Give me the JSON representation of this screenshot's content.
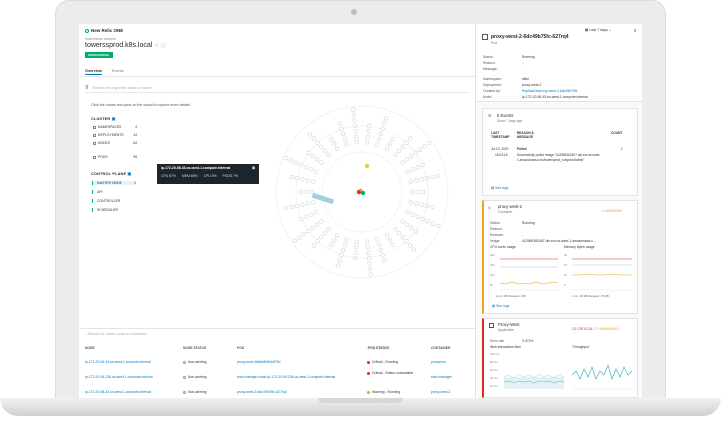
{
  "app": {
    "logo_text": "New Relic ONE",
    "breadcrumb": "Kubernetes clusters",
    "cluster_name": "towerssprod.k8s.local",
    "status_badge": "OPERATIONAL"
  },
  "tabs": [
    "Overview",
    "Events"
  ],
  "filter": {
    "placeholder": "Search for a specific node or name"
  },
  "hint": "Click the nodes and pods on the visual to explore more details.",
  "cluster": {
    "heading": "CLUSTER",
    "rows": [
      {
        "label": "NAMESPACES",
        "value": "4"
      },
      {
        "label": "DEPLOYMENTS",
        "value": "44"
      },
      {
        "label": "NODES",
        "value": "64"
      },
      {
        "label": "PODS",
        "value": "99"
      }
    ]
  },
  "control_plane": {
    "heading": "CONTROL PLANE",
    "items": [
      "MASTER NODE",
      "API",
      "CONTROLLER",
      "SCHEDULER"
    ],
    "master_count": "1"
  },
  "tooltip": {
    "title": "ip-172-20-58-43.us-west-1.compute.internal",
    "metrics": [
      "CPU 57%",
      "MEM 65%",
      "CPU 3%",
      "PODS 7%"
    ]
  },
  "table": {
    "search_placeholder": "Search for nodes, pods or containers",
    "headers": [
      "NODE",
      "NODE STATUS",
      "POD",
      "POD STATUS",
      "CONTAINER"
    ],
    "rows": [
      {
        "node": "ip-172-20-54-44.us-west-1.compute.internal",
        "node_status": "Non-alerting",
        "pod": "proxy-main-5b6dd545d4f79d",
        "pod_status": "Critical - Running",
        "container": "proxymon"
      },
      {
        "node": "ip-172-20-94-236.us-west-1.compute.internal",
        "node_status": "Non-alerting",
        "pod": "etcd-manager-main-ip-172-20-94-236.us-west-1.compute.internal",
        "pod_status": "Critical - Status unavailable",
        "container": "etcd-manager"
      },
      {
        "node": "ip-172-20-58-43.us-west-1.compute.internal",
        "node_status": "Non-alerting",
        "pod": "proxy-west-2-6dc49b75fc-627rq4",
        "pod_status": "Warning - Running",
        "container": "proxy-west-2"
      }
    ]
  },
  "detail": {
    "title": "proxy-west-2-6dc49b75fc-627rq4",
    "type": "Pod",
    "time_range": "Last 7 days",
    "close_icon": "x",
    "fields": [
      {
        "k": "Status:",
        "v": "Running"
      },
      {
        "k": "Reason:",
        "v": "-"
      },
      {
        "k": "Message:",
        "v": "-"
      },
      {
        "k": "Namespace:",
        "v": "sithe"
      },
      {
        "k": "Deployment:",
        "v": "proxy-west-2"
      },
      {
        "k": "Created by:",
        "v": "ReplicaSet/proxy-west-2-6dc49b75fc"
      },
      {
        "k": "Node:",
        "v": "ip-172-20-58-43.us-west-1.compute.internal"
      }
    ],
    "events": {
      "title": "5 Events",
      "sub": "Since 7 days ago",
      "headers": [
        "LAST TIMESTAMP",
        "REASON & MESSAGE",
        "COUNT"
      ],
      "date": "Jul 10, 2020",
      "time": "18:33:18",
      "reason": "Pulled",
      "message": "Successfully pulled image \"412965362467.dkr.ecr.us-west-1.amazonaws.com/towersprod_rubyrand:latest\"",
      "count": "1",
      "see_logs": "See logs"
    },
    "container": {
      "title": "proxy-west-2",
      "type": "Container",
      "status": "1 WARNING",
      "fields": [
        {
          "k": "Status:",
          "v": "Running"
        },
        {
          "k": "Reason:",
          "v": "-"
        },
        {
          "k": "Restarts:",
          "v": "-"
        },
        {
          "k": "Image:",
          "v": "412965362467.dkr.ecr.us-west-1.amazonaws.c..."
        }
      ],
      "cpu_label": "CPU cores usage",
      "mem_label": "Memory bytes usage",
      "cpu_ticks": [
        "200",
        "150",
        "100",
        "50"
      ],
      "mem_ticks": [
        "20",
        "15",
        "10",
        "5"
      ],
      "cpu_legend": [
        "Limit: 200",
        "Request: 138"
      ],
      "mem_legend": [
        "1 mL: 20 MB",
        "Request: 15 MB"
      ],
      "see_logs": "See logs"
    },
    "app_card": {
      "title": "Proxy-West",
      "type": "Application",
      "status": "23 CRITICAL",
      "status_warn": "27 WARNINGS",
      "error_rate_label": "Error rate",
      "error_rate": "0.472%",
      "txn_label": "Web transaction time",
      "throughput_label": "Throughput",
      "txn_ticks": [
        "100 ms",
        "80 ms",
        "60 ms",
        "40 ms",
        "20 ms"
      ]
    }
  },
  "colors": {
    "accent": "#0079bf",
    "ok": "#00ac69",
    "warning": "#f5a020",
    "critical": "#df2d24",
    "teal": "#9fd0dc"
  }
}
